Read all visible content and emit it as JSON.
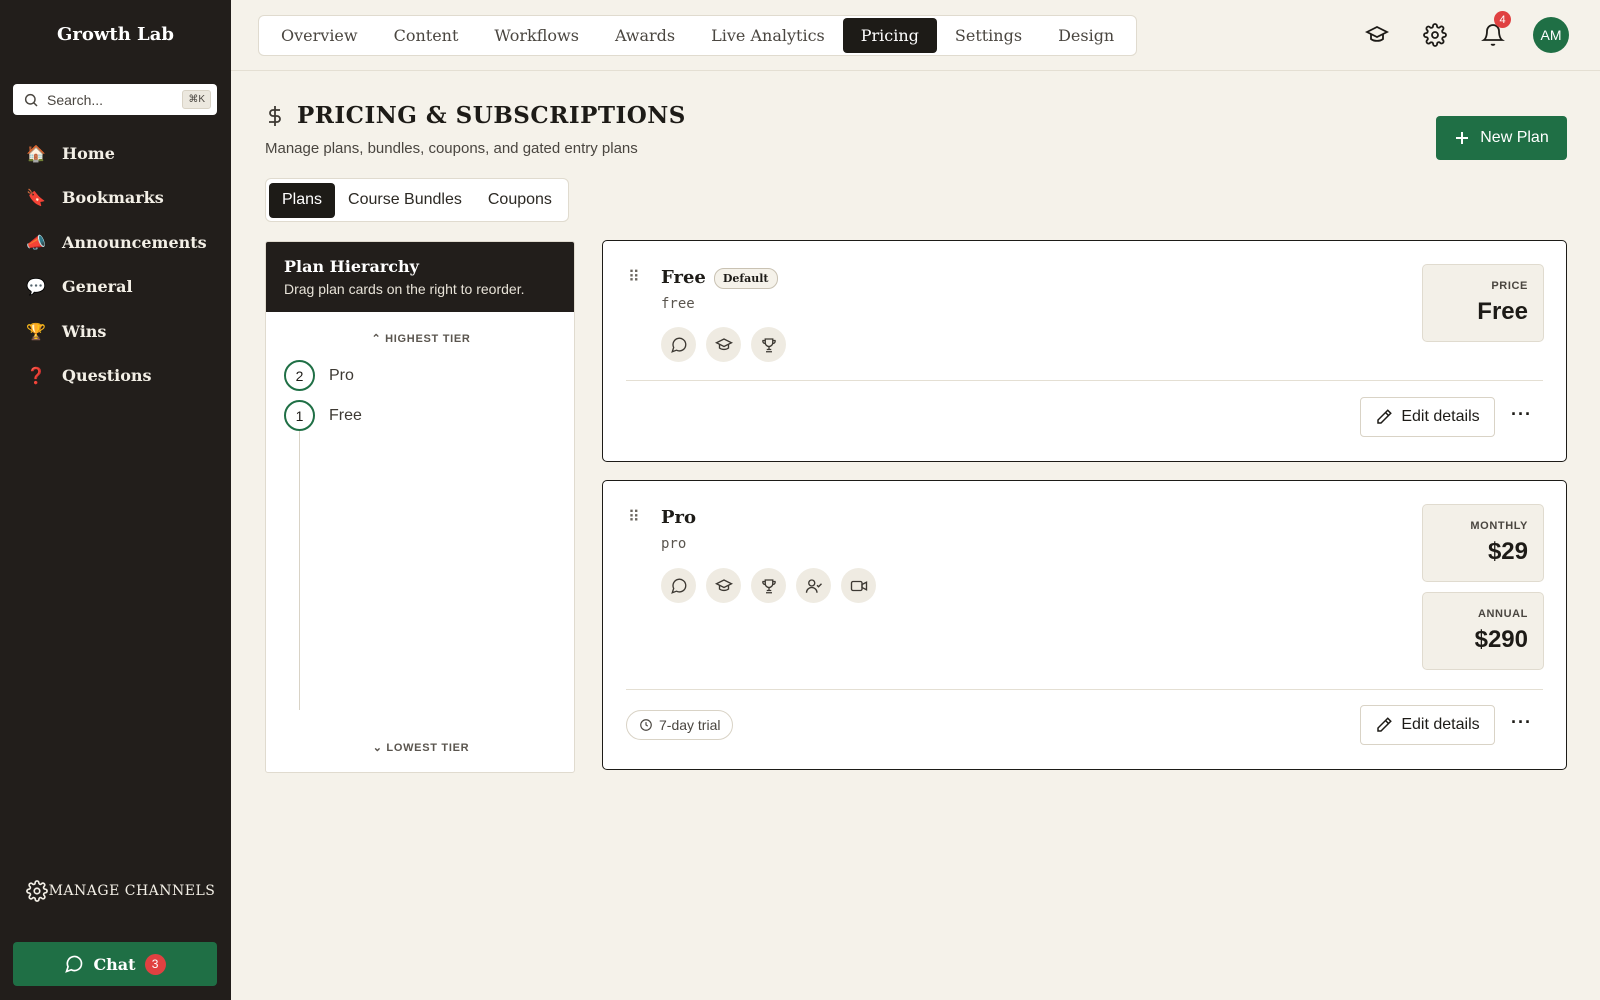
{
  "app": {
    "name": "Growth Lab"
  },
  "sidebar": {
    "search_placeholder": "Search...",
    "search_shortcut": "⌘K",
    "items": [
      {
        "emoji": "🏠",
        "label": "Home"
      },
      {
        "emoji": "🔖",
        "label": "Bookmarks"
      },
      {
        "emoji": "📣",
        "label": "Announcements"
      },
      {
        "emoji": "💬",
        "label": "General"
      },
      {
        "emoji": "🏆",
        "label": "Wins"
      },
      {
        "emoji": "❓",
        "label": "Questions"
      }
    ],
    "manage_label": "MANAGE CHANNELS",
    "chat_label": "Chat",
    "chat_count": "3"
  },
  "topnav": {
    "tabs": [
      "Overview",
      "Content",
      "Workflows",
      "Awards",
      "Live Analytics",
      "Pricing",
      "Settings",
      "Design"
    ],
    "active_tab": "Pricing",
    "notification_count": "4",
    "avatar_initials": "AM"
  },
  "page": {
    "title": "PRICING & SUBSCRIPTIONS",
    "subtitle": "Manage plans, bundles, coupons, and gated entry plans",
    "new_plan_label": "New Plan",
    "subtabs": [
      "Plans",
      "Course Bundles",
      "Coupons"
    ],
    "active_subtab": "Plans"
  },
  "hierarchy": {
    "title": "Plan Hierarchy",
    "subtitle": "Drag plan cards on the right to reorder.",
    "highest_label": "HIGHEST TIER",
    "lowest_label": "LOWEST TIER",
    "tiers": [
      {
        "rank": "2",
        "name": "Pro"
      },
      {
        "rank": "1",
        "name": "Free"
      }
    ]
  },
  "plans": [
    {
      "name": "Free",
      "badge": "Default",
      "slug": "free",
      "features": [
        "chat-icon",
        "graduation-cap-icon",
        "trophy-icon"
      ],
      "prices": [
        {
          "label": "PRICE",
          "value": "Free"
        }
      ],
      "edit_label": "Edit details",
      "more_label": "···"
    },
    {
      "name": "Pro",
      "slug": "pro",
      "features": [
        "chat-icon",
        "graduation-cap-icon",
        "trophy-icon",
        "user-check-icon",
        "video-icon"
      ],
      "prices": [
        {
          "label": "MONTHLY",
          "value": "$29"
        },
        {
          "label": "ANNUAL",
          "value": "$290"
        }
      ],
      "trial": "7-day trial",
      "edit_label": "Edit details",
      "more_label": "···"
    }
  ],
  "colors": {
    "accent": "#1f6f45",
    "sidebar": "#221e1b",
    "background": "#f5f2ea",
    "badge": "#e04141"
  }
}
